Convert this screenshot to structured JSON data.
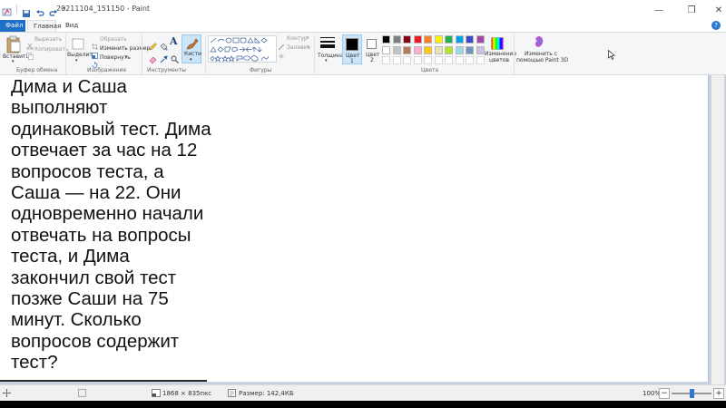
{
  "window": {
    "title": "20211104_151150 - Paint",
    "controls": [
      "—",
      "❐",
      "✕"
    ]
  },
  "tabs": [
    {
      "label": "Файл"
    },
    {
      "label": "Главная"
    },
    {
      "label": "Вид"
    }
  ],
  "help_glyph": "?",
  "ribbon": {
    "clipboard": {
      "paste_label": "Вставить",
      "cut_label": "Вырезать",
      "copy_label": "Копировать",
      "group_label": "Буфер обмена"
    },
    "image": {
      "select_label": "Выделить",
      "crop_label": "Обрезать",
      "resize_label": "Изменить размер",
      "rotate_label": "Повернуть",
      "group_label": "Изображение"
    },
    "tools": {
      "group_label": "Инструменты",
      "text_glyph": "A"
    },
    "brushes": {
      "label": "Кисти"
    },
    "shapes": {
      "outline_label": "Контур",
      "fill_label": "Заливка",
      "group_label": "Фигуры"
    },
    "thickness": {
      "label": "Толщина"
    },
    "color1": {
      "label_line1": "Цвет",
      "label_line2": "1"
    },
    "color2": {
      "label_line1": "Цвет",
      "label_line2": "2"
    },
    "colors": {
      "group_label": "Цвета",
      "edit_label_line1": "Изменение",
      "edit_label_line2": "цветов",
      "row1": [
        "#000000",
        "#7f7f7f",
        "#880015",
        "#ed1c24",
        "#ff7f27",
        "#fff200",
        "#22b14c",
        "#00a2e8",
        "#3f48cc",
        "#a349a4"
      ],
      "row2": [
        "#ffffff",
        "#c3c3c3",
        "#b97a57",
        "#ffaec9",
        "#ffc90e",
        "#efe4b0",
        "#b5e61d",
        "#99d9ea",
        "#7092be",
        "#c8bfe7"
      ]
    },
    "paint3d": {
      "label_line1": "Изменить с",
      "label_line2": "помощью Paint 3D"
    }
  },
  "canvas": {
    "problem_text": "Дима и Саша выполняют одинаковый тест. Дима отвечает за час на 12 вопросов теста, а Саша — на 22. Они одновременно начали отвечать на вопросы теста, и Дима закончил свой тест позже Саши на 75 минут. Сколько вопросов содержит тест?"
  },
  "status": {
    "dimensions": "1868 × 835пкс",
    "size": "Размер: 142,4КБ",
    "zoom": "100%",
    "zoom_level_percent": 100
  }
}
